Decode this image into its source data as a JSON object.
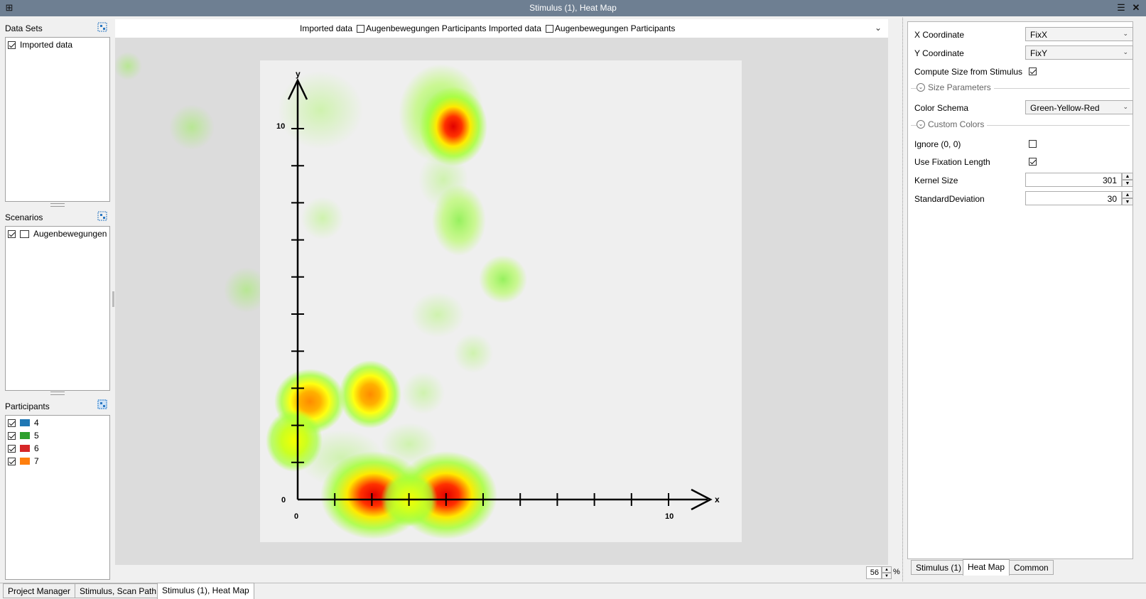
{
  "window": {
    "title": "Stimulus (1), Heat Map"
  },
  "left": {
    "datasets": {
      "title": "Data Sets",
      "items": [
        {
          "label": "Imported data",
          "checked": true
        }
      ]
    },
    "scenarios": {
      "title": "Scenarios",
      "items": [
        {
          "label": "Augenbewegungen",
          "checked": true
        }
      ]
    },
    "participants": {
      "title": "Participants",
      "items": [
        {
          "label": "4",
          "checked": true,
          "color": "#1f77b4"
        },
        {
          "label": "5",
          "checked": true,
          "color": "#2ca02c"
        },
        {
          "label": "6",
          "checked": true,
          "color": "#d62728"
        },
        {
          "label": "7",
          "checked": true,
          "color": "#ff7f0e"
        }
      ]
    }
  },
  "center": {
    "header": {
      "part1": "Imported data",
      "part2": "Augenbewegungen Participants Imported data",
      "part3": "Augenbewegungen Participants"
    },
    "plot": {
      "x_label": "x",
      "y_label": "y",
      "x_tick_0": "0",
      "x_tick_10": "10",
      "y_tick_0": "0",
      "y_tick_10": "10"
    },
    "zoom": {
      "value": "56",
      "unit": "%"
    }
  },
  "props": {
    "x_coord": {
      "label": "X Coordinate",
      "value": "FixX"
    },
    "y_coord": {
      "label": "Y Coordinate",
      "value": "FixY"
    },
    "compute_size": {
      "label": "Compute Size from Stimulus",
      "checked": true
    },
    "size_params": {
      "label": "Size Parameters"
    },
    "color_schema": {
      "label": "Color Schema",
      "value": "Green-Yellow-Red"
    },
    "custom_colors": {
      "label": "Custom Colors"
    },
    "ignore_zero": {
      "label": "Ignore (0, 0)",
      "checked": false
    },
    "use_fix_len": {
      "label": "Use Fixation Length",
      "checked": true
    },
    "kernel_size": {
      "label": "Kernel Size",
      "value": "301"
    },
    "std_dev": {
      "label": "StandardDeviation",
      "value": "30"
    },
    "tabs": [
      {
        "label": "Stimulus (1)"
      },
      {
        "label": "Heat Map",
        "active": true
      },
      {
        "label": "Common"
      }
    ]
  },
  "bottom_tabs": [
    {
      "label": "Project Manager"
    },
    {
      "label": "Stimulus, Scan Path"
    },
    {
      "label": "Stimulus (1), Heat Map",
      "active": true
    }
  ]
}
